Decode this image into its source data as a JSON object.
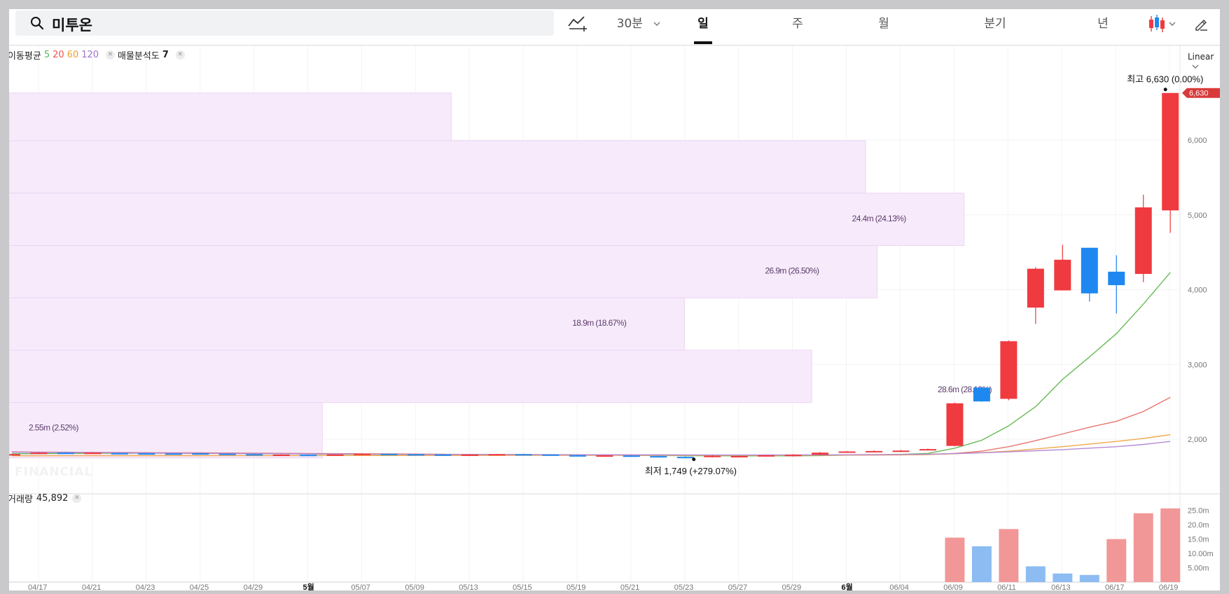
{
  "header": {
    "search_value": "미투온",
    "interval_label": "30분",
    "tabs": [
      {
        "label": "일",
        "active": true
      },
      {
        "label": "주",
        "active": false
      },
      {
        "label": "월",
        "active": false
      },
      {
        "label": "분기",
        "active": false
      },
      {
        "label": "년",
        "active": false
      }
    ]
  },
  "indicators": {
    "ma_label": "이동평균",
    "ma_periods": [
      {
        "value": "5",
        "color": "#5cb85c"
      },
      {
        "value": "20",
        "color": "#e8534f"
      },
      {
        "value": "60",
        "color": "#f0a030"
      },
      {
        "value": "120",
        "color": "#a070d0"
      }
    ],
    "volume_profile_label": "매물분석도",
    "volume_profile_value": "7",
    "volume_label": "거래량",
    "volume_value": "45,892"
  },
  "scale": {
    "mode": "Linear"
  },
  "chart_data": {
    "type": "candlestick",
    "y_axis": {
      "ticks": [
        "6,000",
        "5,000",
        "4,000",
        "3,000",
        "2,000"
      ],
      "ylim": [
        1500,
        7100
      ]
    },
    "current_price_tag": "6,630",
    "high_annotation": {
      "prefix": "최고",
      "value": "6,630",
      "suffix": "(0.00%)"
    },
    "low_annotation": {
      "prefix": "최저",
      "value": "1,749",
      "suffix": "(+279.07%)"
    },
    "x_ticks": [
      "04/17",
      "04/21",
      "04/23",
      "04/25",
      "04/29",
      "5월",
      "05/07",
      "05/09",
      "05/13",
      "05/15",
      "05/19",
      "05/21",
      "05/23",
      "05/27",
      "05/29",
      "6월",
      "06/04",
      "06/09",
      "06/11",
      "06/13",
      "06/17",
      "06/19"
    ],
    "candles": [
      {
        "o": 1796,
        "h": 1805,
        "l": 1788,
        "c": 1800
      },
      {
        "o": 1810,
        "h": 1828,
        "l": 1800,
        "c": 1820
      },
      {
        "o": 1820,
        "h": 1830,
        "l": 1810,
        "c": 1815
      },
      {
        "o": 1815,
        "h": 1828,
        "l": 1810,
        "c": 1820
      },
      {
        "o": 1815,
        "h": 1820,
        "l": 1805,
        "c": 1810
      },
      {
        "o": 1812,
        "h": 1818,
        "l": 1805,
        "c": 1808
      },
      {
        "o": 1810,
        "h": 1815,
        "l": 1800,
        "c": 1805
      },
      {
        "o": 1812,
        "h": 1818,
        "l": 1806,
        "c": 1810
      },
      {
        "o": 1806,
        "h": 1812,
        "l": 1798,
        "c": 1800
      },
      {
        "o": 1800,
        "h": 1806,
        "l": 1790,
        "c": 1795
      },
      {
        "o": 1790,
        "h": 1798,
        "l": 1782,
        "c": 1794
      },
      {
        "o": 1792,
        "h": 1798,
        "l": 1785,
        "c": 1788
      },
      {
        "o": 1786,
        "h": 1800,
        "l": 1780,
        "c": 1796
      },
      {
        "o": 1800,
        "h": 1810,
        "l": 1795,
        "c": 1805
      },
      {
        "o": 1805,
        "h": 1810,
        "l": 1796,
        "c": 1800
      },
      {
        "o": 1800,
        "h": 1806,
        "l": 1792,
        "c": 1798
      },
      {
        "o": 1796,
        "h": 1802,
        "l": 1790,
        "c": 1795
      },
      {
        "o": 1785,
        "h": 1800,
        "l": 1780,
        "c": 1795
      },
      {
        "o": 1798,
        "h": 1804,
        "l": 1790,
        "c": 1800
      },
      {
        "o": 1800,
        "h": 1806,
        "l": 1792,
        "c": 1796
      },
      {
        "o": 1796,
        "h": 1800,
        "l": 1780,
        "c": 1785
      },
      {
        "o": 1786,
        "h": 1792,
        "l": 1776,
        "c": 1780
      },
      {
        "o": 1780,
        "h": 1788,
        "l": 1772,
        "c": 1784
      },
      {
        "o": 1782,
        "h": 1788,
        "l": 1772,
        "c": 1776
      },
      {
        "o": 1774,
        "h": 1780,
        "l": 1765,
        "c": 1770
      },
      {
        "o": 1764,
        "h": 1770,
        "l": 1749,
        "c": 1760
      },
      {
        "o": 1762,
        "h": 1790,
        "l": 1755,
        "c": 1778
      },
      {
        "o": 1770,
        "h": 1780,
        "l": 1762,
        "c": 1775
      },
      {
        "o": 1774,
        "h": 1790,
        "l": 1768,
        "c": 1786
      },
      {
        "o": 1772,
        "h": 1800,
        "l": 1768,
        "c": 1792
      },
      {
        "o": 1792,
        "h": 1830,
        "l": 1786,
        "c": 1820
      },
      {
        "o": 1825,
        "h": 1842,
        "l": 1818,
        "c": 1836
      },
      {
        "o": 1836,
        "h": 1850,
        "l": 1828,
        "c": 1842
      },
      {
        "o": 1838,
        "h": 1856,
        "l": 1830,
        "c": 1848
      },
      {
        "o": 1855,
        "h": 1875,
        "l": 1848,
        "c": 1868
      },
      {
        "o": 1910,
        "h": 2490,
        "l": 1905,
        "c": 2480
      },
      {
        "o": 2690,
        "h": 2690,
        "l": 2500,
        "c": 2505
      },
      {
        "o": 2540,
        "h": 3320,
        "l": 2520,
        "c": 3310
      },
      {
        "o": 3760,
        "h": 4300,
        "l": 3540,
        "c": 4280
      },
      {
        "o": 3990,
        "h": 4600,
        "l": 3990,
        "c": 4400
      },
      {
        "o": 4560,
        "h": 4560,
        "l": 3840,
        "c": 3950
      },
      {
        "o": 4240,
        "h": 4460,
        "l": 3680,
        "c": 4060
      },
      {
        "o": 4210,
        "h": 5270,
        "l": 4100,
        "c": 5100
      },
      {
        "o": 5060,
        "h": 6630,
        "l": 4760,
        "c": 6630
      }
    ],
    "moving_averages": [
      {
        "period": 5,
        "color": "#66bb55",
        "values": [
          1805,
          1808,
          1810,
          1812,
          1813,
          1814,
          1813,
          1812,
          1810,
          1808,
          1805,
          1802,
          1800,
          1798,
          1797,
          1797,
          1797,
          1796,
          1795,
          1794,
          1792,
          1790,
          1788,
          1785,
          1782,
          1780,
          1778,
          1777,
          1777,
          1778,
          1781,
          1786,
          1791,
          1797,
          1810,
          1880,
          1986,
          2179,
          2436,
          2800,
          3100,
          3413,
          3806,
          4230
        ]
      },
      {
        "period": 20,
        "color": "#e8766f",
        "values": [
          1830,
          1828,
          1826,
          1824,
          1822,
          1820,
          1818,
          1817,
          1815,
          1813,
          1811,
          1809,
          1807,
          1805,
          1803,
          1801,
          1799,
          1797,
          1795,
          1794,
          1793,
          1792,
          1791,
          1790,
          1789,
          1788,
          1787,
          1786,
          1786,
          1786,
          1787,
          1788,
          1789,
          1790,
          1795,
          1810,
          1840,
          1900,
          1980,
          2070,
          2160,
          2240,
          2370,
          2560
        ]
      },
      {
        "period": 60,
        "color": "#f0a84c",
        "values": [
          1778,
          1778,
          1779,
          1779,
          1779,
          1780,
          1780,
          1780,
          1781,
          1781,
          1781,
          1782,
          1782,
          1782,
          1782,
          1783,
          1783,
          1783,
          1783,
          1784,
          1784,
          1784,
          1784,
          1784,
          1784,
          1784,
          1784,
          1784,
          1785,
          1785,
          1786,
          1787,
          1788,
          1790,
          1795,
          1805,
          1820,
          1840,
          1870,
          1900,
          1935,
          1970,
          2010,
          2060
        ]
      },
      {
        "period": 120,
        "color": "#b58ad6",
        "values": [
          1826,
          1824,
          1822,
          1820,
          1818,
          1816,
          1814,
          1812,
          1810,
          1808,
          1806,
          1804,
          1802,
          1800,
          1798,
          1797,
          1796,
          1795,
          1794,
          1793,
          1792,
          1791,
          1790,
          1789,
          1789,
          1788,
          1788,
          1788,
          1788,
          1789,
          1790,
          1792,
          1794,
          1796,
          1800,
          1808,
          1818,
          1830,
          1845,
          1860,
          1880,
          1900,
          1930,
          1970
        ]
      }
    ],
    "volume_profile": [
      {
        "from": 6630,
        "to": 5990,
        "fraction": 0.3776,
        "label": ""
      },
      {
        "from": 5990,
        "to": 5290,
        "fraction": 0.7315,
        "label": ""
      },
      {
        "from": 5290,
        "to": 4590,
        "fraction": 0.8156,
        "label": "24.4m (24.13%)"
      },
      {
        "from": 4590,
        "to": 3890,
        "fraction": 0.7413,
        "label": "26.9m (26.50%)"
      },
      {
        "from": 3890,
        "to": 3190,
        "fraction": 0.5767,
        "label": "18.9m (18.67%)"
      },
      {
        "from": 3190,
        "to": 2490,
        "fraction": 0.6855,
        "label": ""
      },
      {
        "from": 2490,
        "to": 1749,
        "fraction": 0.2675,
        "label": "2.55m (2.52%)"
      },
      {
        "from": null,
        "to": null,
        "fraction": 0,
        "label": "28.6m (28.19%)"
      }
    ],
    "volume": {
      "ticks": [
        "25.0m",
        "20.0m",
        "15.0m",
        "10.00m",
        "5.00m"
      ],
      "ylim": [
        0,
        27.6
      ],
      "bars": [
        {
          "index": 35,
          "value": 15.5,
          "up": true
        },
        {
          "index": 36,
          "value": 12.5,
          "up": false
        },
        {
          "index": 37,
          "value": 18.5,
          "up": true
        },
        {
          "index": 38,
          "value": 5.5,
          "up": false
        },
        {
          "index": 39,
          "value": 3.0,
          "up": false
        },
        {
          "index": 40,
          "value": 2.5,
          "up": false
        },
        {
          "index": 41,
          "value": 15.0,
          "up": true
        },
        {
          "index": 42,
          "value": 24.0,
          "up": true
        },
        {
          "index": 43,
          "value": 25.7,
          "up": true
        }
      ]
    }
  },
  "colors": {
    "up": "#ef3a3f",
    "down": "#1e88f0",
    "up_volume": "#f29797",
    "down_volume": "#8cbcf2",
    "profile_fill": "#f7ebfb",
    "profile_stroke": "#ecd3f5",
    "profile_text": "#5b3a6b",
    "price_tag": "#d93a3a"
  },
  "watermark_text": "FINANCIAL"
}
